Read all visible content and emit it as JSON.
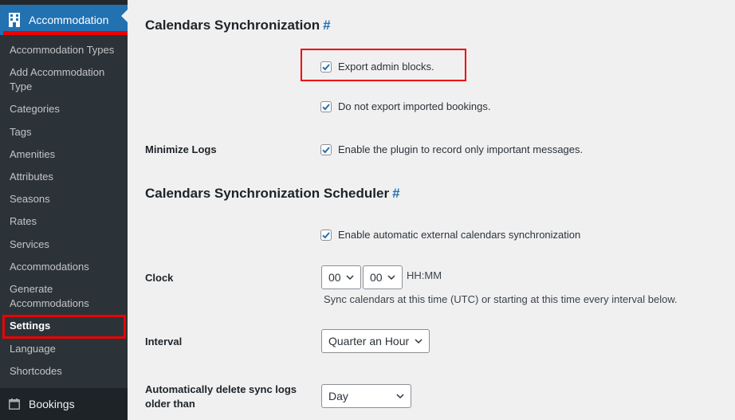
{
  "sidebar": {
    "menu_title": "Accommodation",
    "items": [
      {
        "label": "Accommodation Types"
      },
      {
        "label": "Add Accommodation Type"
      },
      {
        "label": "Categories"
      },
      {
        "label": "Tags"
      },
      {
        "label": "Amenities"
      },
      {
        "label": "Attributes"
      },
      {
        "label": "Seasons"
      },
      {
        "label": "Rates"
      },
      {
        "label": "Services"
      },
      {
        "label": "Accommodations"
      },
      {
        "label": "Generate Accommodations"
      },
      {
        "label": "Settings"
      },
      {
        "label": "Language"
      },
      {
        "label": "Shortcodes"
      }
    ],
    "current_item": "Settings",
    "next_menu": "Bookings"
  },
  "sections": {
    "sync_title": "Calendars Synchronization",
    "scheduler_title": "Calendars Synchronization Scheduler",
    "hash": "#"
  },
  "fields": {
    "export_admin_blocks": {
      "label": "Export admin blocks.",
      "checked": true
    },
    "no_export_imported": {
      "label": "Do not export imported bookings.",
      "checked": true
    },
    "minimize_logs": {
      "row_label": "Minimize Logs",
      "label": "Enable the plugin to record only important messages.",
      "checked": true
    },
    "auto_sync": {
      "label": "Enable automatic external calendars synchronization",
      "checked": true
    },
    "clock": {
      "row_label": "Clock",
      "hours": "00",
      "minutes": "00",
      "format": "HH:MM",
      "hint": "Sync calendars at this time (UTC) or starting at this time every interval below."
    },
    "interval": {
      "row_label": "Interval",
      "value": "Quarter an Hour"
    },
    "delete_logs": {
      "row_label": "Automatically delete sync logs older than",
      "value": "Day"
    }
  },
  "colors": {
    "accent": "#2271b1",
    "highlight": "#ee0000",
    "sidebar_bg": "#2c3338"
  }
}
